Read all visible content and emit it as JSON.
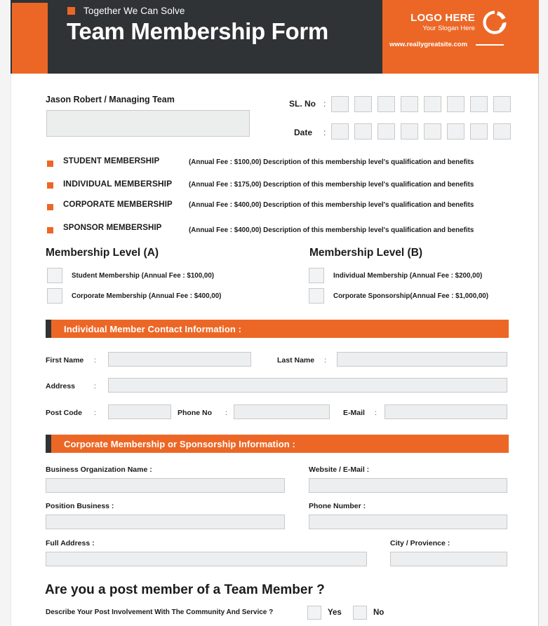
{
  "header": {
    "tagline": "Together We Can Solve",
    "title": "Team Membership Form",
    "logo_title": "LOGO HERE",
    "logo_slogan": "Your Slogan Here",
    "website": "www.reallygreatsite.com",
    "colors": {
      "orange": "#ec6726",
      "dark": "#303335"
    }
  },
  "top": {
    "owner_name": "Jason Robert / Managing Team",
    "slno_label": "SL. No",
    "date_label": "Date",
    "colon": ":",
    "slno_cells": 8,
    "date_cells": 8
  },
  "membership_levels": [
    {
      "name": "STUDENT MEMBERSHIP",
      "desc": "(Annual Fee : $100,00) Description of this membership level's qualification and benefits"
    },
    {
      "name": "INDIVIDUAL MEMBERSHIP",
      "desc": "(Annual Fee : $175,00) Description of this membership level's qualification and benefits"
    },
    {
      "name": "CORPORATE MEMBERSHIP",
      "desc": "(Annual Fee : $400,00) Description of this membership level's qualification and benefits"
    },
    {
      "name": "SPONSOR MEMBERSHIP",
      "desc": "(Annual Fee : $400,00) Description of this membership level's qualification and benefits"
    }
  ],
  "level_a": {
    "title": "Membership Level (A)",
    "options": [
      "Student Membership (Annual Fee : $100,00)",
      "Corporate Membership (Annual Fee : $400,00)"
    ]
  },
  "level_b": {
    "title": "Membership Level (B)",
    "options": [
      "Individual Membership (Annual Fee : $200,00)",
      "Corporate Sponsorship(Annual Fee : $1,000,00)"
    ]
  },
  "section_contact": {
    "heading": "Individual Member Contact Information :",
    "first_name_label": "First Name",
    "last_name_label": "Last Name",
    "address_label": "Address",
    "post_code_label": "Post Code",
    "phone_no_label": "Phone No",
    "email_label": "E-Mail",
    "colon": ":",
    "values": {
      "first_name": "",
      "last_name": "",
      "address": "",
      "post_code": "",
      "phone_no": "",
      "email": ""
    }
  },
  "section_corporate": {
    "heading": "Corporate Membership or Sponsorship Information :",
    "business_name_label": "Business Organization Name :",
    "website_label": "Website / E-Mail :",
    "position_label": "Position Business :",
    "phone_number_label": "Phone Number :",
    "full_address_label": "Full Address :",
    "city_label": "City / Provience :",
    "values": {
      "business_name": "",
      "website": "",
      "position": "",
      "phone_number": "",
      "full_address": "",
      "city": ""
    }
  },
  "bottom": {
    "question": "Are you a post member of a Team Member ?",
    "subquestion": "Describe Your Post Involvement With The Community And Service ?",
    "yes_label": "Yes",
    "no_label": "No"
  }
}
